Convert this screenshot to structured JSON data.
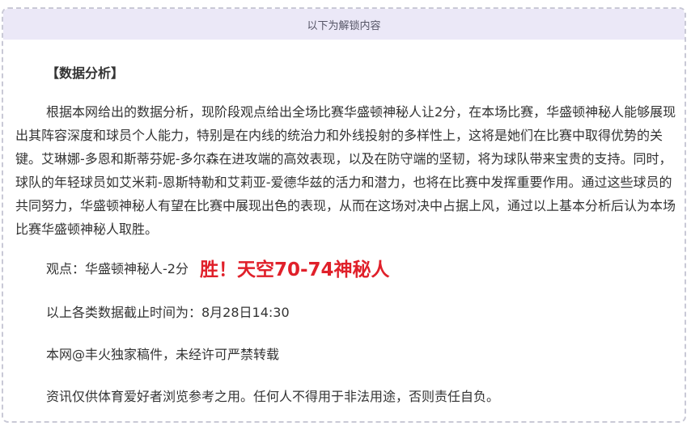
{
  "unlock_header": "以下为解锁内容",
  "section_title": "【数据分析】",
  "analysis_text": "根据本网给出的数据分析，现阶段观点给出全场比赛华盛顿神秘人让2分，在本场比赛，华盛顿神秘人能够展现出其阵容深度和球员个人能力，特别是在内线的统治力和外线投射的多样性上，这将是她们在比赛中取得优势的关键。艾琳娜-多恩和斯蒂芬妮-多尔森在进攻端的高效表现，以及在防守端的坚韧，将为球队带来宝贵的支持。同时，球队的年轻球员如艾米莉-恩斯特勒和艾莉亚-爱德华兹的活力和潜力，也将在比赛中发挥重要作用。通过这些球员的共同努力，华盛顿神秘人有望在比赛中展现出色的表现，从而在这场对决中占据上风，通过以上基本分析后认为本场比赛华盛顿神秘人取胜。",
  "verdict": {
    "label": "观点：华盛顿神秘人-2分",
    "result": "胜！天空70-74神秘人",
    "result_color": "#e0202a"
  },
  "cutoff_time": "以上各类数据截止时间为：8月28日14:30",
  "copyright": "本网@丰火独家稿件，未经许可严禁转载",
  "disclaimer": "资讯仅供体育爱好者浏览参考之用。任何人不得用于非法用途，否则责任自负。",
  "colors": {
    "header_bg": "#ebe8f7",
    "border": "#c9c9d6",
    "text": "#333333"
  }
}
